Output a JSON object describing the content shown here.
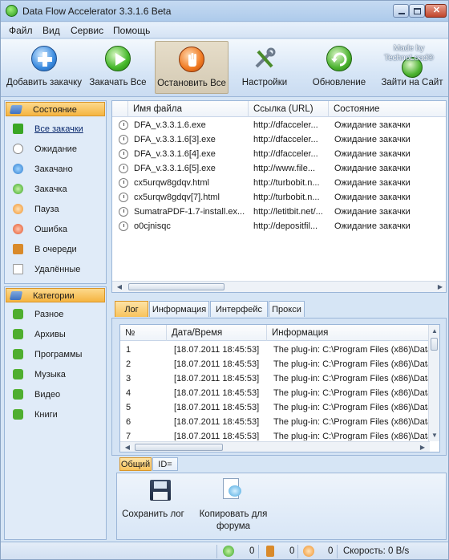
{
  "window": {
    "title": "Data Flow Accelerator 3.3.1.6 Beta"
  },
  "menu": [
    "Файл",
    "Вид",
    "Сервис",
    "Помощь"
  ],
  "toolbar": {
    "buttons": [
      {
        "label": "Добавить закачку",
        "icon": "add-icon"
      },
      {
        "label": "Закачать Все",
        "icon": "play-icon"
      },
      {
        "label": "Остановить Все",
        "icon": "stop-hand-icon"
      },
      {
        "label": "Настройки",
        "icon": "tools-icon"
      },
      {
        "label": "Обновление",
        "icon": "refresh-icon"
      },
      {
        "label": "Зайти на Сайт",
        "icon": "globe-icon"
      }
    ],
    "brand": "Made by TechnoLoad®"
  },
  "sidebar": {
    "status_title": "Состояние",
    "status_items": [
      "Все закачки",
      "Ожидание",
      "Закачано",
      "Закачка",
      "Пауза",
      "Ошибка",
      "В очереди",
      "Удалённые"
    ],
    "categories_title": "Категории",
    "category_items": [
      "Разное",
      "Архивы",
      "Программы",
      "Музыка",
      "Видео",
      "Книги"
    ]
  },
  "files": {
    "columns": [
      "Имя файла",
      "Ссылка (URL)",
      "Состояние"
    ],
    "rows": [
      [
        "DFA_v.3.3.1.6.exe",
        "http://dfacceler...",
        "Ожидание закачки"
      ],
      [
        "DFA_v.3.3.1.6[3].exe",
        "http://dfacceler...",
        "Ожидание закачки"
      ],
      [
        "DFA_v.3.3.1.6[4].exe",
        "http://dfacceler...",
        "Ожидание закачки"
      ],
      [
        "DFA_v.3.3.1.6[5].exe",
        "http://www.file...",
        "Ожидание закачки"
      ],
      [
        "cx5urqw8gdqv.html",
        "http://turbobit.n...",
        "Ожидание закачки"
      ],
      [
        "cx5urqw8gdqv[7].html",
        "http://turbobit.n...",
        "Ожидание закачки"
      ],
      [
        "SumatraPDF-1.7-install.ex...",
        "http://letitbit.net/...",
        "Ожидание закачки"
      ],
      [
        "o0cjnisqc",
        "http://depositfil...",
        "Ожидание закачки"
      ]
    ]
  },
  "tabs": [
    "Лог",
    "Информация",
    "Интерфейс",
    "Прокси"
  ],
  "log": {
    "columns": [
      "№",
      "Дата/Время",
      "Информация"
    ],
    "rows": [
      [
        "1",
        "[18.07.2011 18:45:53]",
        "The plug-in: C:\\Program Files (x86)\\Data"
      ],
      [
        "2",
        "[18.07.2011 18:45:53]",
        "The plug-in: C:\\Program Files (x86)\\Data"
      ],
      [
        "3",
        "[18.07.2011 18:45:53]",
        "The plug-in: C:\\Program Files (x86)\\Data"
      ],
      [
        "4",
        "[18.07.2011 18:45:53]",
        "The plug-in: C:\\Program Files (x86)\\Data"
      ],
      [
        "5",
        "[18.07.2011 18:45:53]",
        "The plug-in: C:\\Program Files (x86)\\Data"
      ],
      [
        "6",
        "[18.07.2011 18:45:53]",
        "The plug-in: C:\\Program Files (x86)\\Data"
      ],
      [
        "7",
        "[18.07.2011 18:45:53]",
        "The plug-in: C:\\Program Files (x86)\\Data"
      ]
    ]
  },
  "subtabs": [
    "Общий",
    "ID="
  ],
  "actions": {
    "save_log": "Сохранить лог",
    "copy_forum": "Копировать для форума"
  },
  "status": {
    "active": "0",
    "queued": "0",
    "done": "0",
    "speed": "Скорость: 0 B/s"
  }
}
